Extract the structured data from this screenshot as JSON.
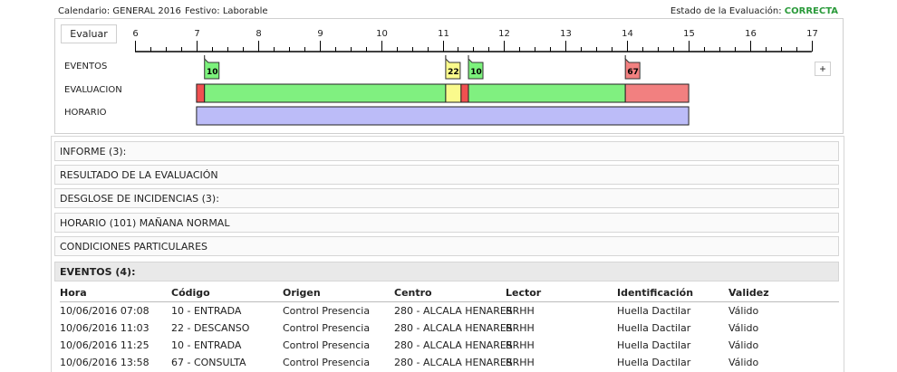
{
  "header": {
    "calendar": "Calendario: GENERAL 2016",
    "holiday": "Festivo: Laborable",
    "status_label": "Estado de la Evaluación:",
    "status_value": "CORRECTA",
    "status_color": "#2a9a3a"
  },
  "timeline": {
    "evaluate_button": "Evaluar",
    "plus_button": "+",
    "hour_start": 6,
    "hour_end": 17,
    "labels": {
      "events": "EVENTOS",
      "evaluation": "EVALUACION",
      "schedule": "HORARIO"
    },
    "events": [
      {
        "code": "10",
        "time": 7.13,
        "color": "#7cf27c"
      },
      {
        "code": "22",
        "time": 11.05,
        "color": "#fafa8c"
      },
      {
        "code": "10",
        "time": 11.42,
        "color": "#7cf27c"
      },
      {
        "code": "67",
        "time": 13.97,
        "color": "#f28080"
      }
    ],
    "evaluation_segments": [
      {
        "start": 7.0,
        "end": 7.13,
        "color": "#f05050"
      },
      {
        "start": 7.13,
        "end": 11.05,
        "color": "#80f080"
      },
      {
        "start": 11.05,
        "end": 11.3,
        "color": "#fafa8c"
      },
      {
        "start": 11.3,
        "end": 11.42,
        "color": "#f05050"
      },
      {
        "start": 11.42,
        "end": 13.97,
        "color": "#80f080"
      },
      {
        "start": 13.97,
        "end": 15.0,
        "color": "#f28080"
      }
    ],
    "schedule": {
      "start": 7.0,
      "end": 15.0,
      "color": "#bcbcf8"
    }
  },
  "sections": [
    "INFORME (3):",
    "RESULTADO DE LA EVALUACIÓN",
    "DESGLOSE DE INCIDENCIAS (3):",
    "HORARIO (101) MAÑANA NORMAL",
    "CONDICIONES PARTICULARES"
  ],
  "events_section": {
    "title": "EVENTOS (4):",
    "columns": [
      "Hora",
      "Código",
      "Origen",
      "Centro",
      "Lector",
      "Identificación",
      "Validez"
    ],
    "rows": [
      [
        "10/06/2016 07:08",
        "10 - ENTRADA",
        "Control Presencia",
        "280 - ALCALA HENARES",
        "RRHH",
        "Huella Dactilar",
        "Válido"
      ],
      [
        "10/06/2016 11:03",
        "22 - DESCANSO",
        "Control Presencia",
        "280 - ALCALA HENARES",
        "RRHH",
        "Huella Dactilar",
        "Válido"
      ],
      [
        "10/06/2016 11:25",
        "10 - ENTRADA",
        "Control Presencia",
        "280 - ALCALA HENARES",
        "RRHH",
        "Huella Dactilar",
        "Válido"
      ],
      [
        "10/06/2016 13:58",
        "67 - CONSULTA",
        "Control Presencia",
        "280 - ALCALA HENARES",
        "RRHH",
        "Huella Dactilar",
        "Válido"
      ]
    ]
  }
}
